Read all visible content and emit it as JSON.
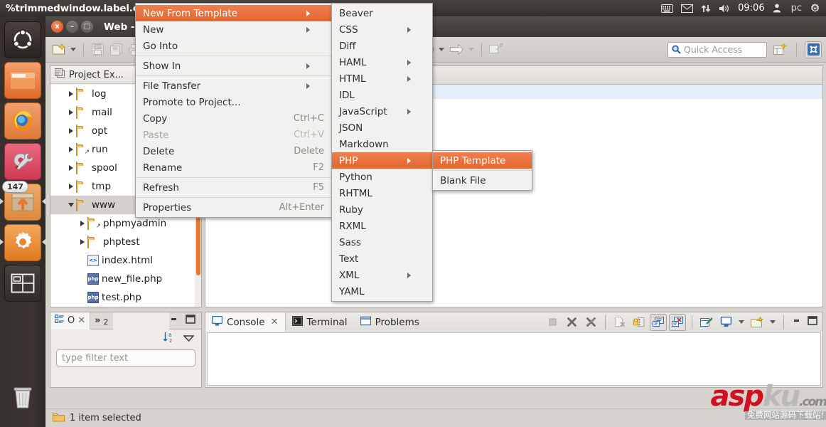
{
  "top_panel": {
    "app_menu_title": "%trimmedwindow.label.e",
    "indicators": [
      {
        "name": "keyboard-indicator-icon",
        "glyph": "⌨"
      },
      {
        "name": "messaging-indicator-icon",
        "glyph": "✉"
      },
      {
        "name": "network-indicator-icon",
        "glyph": "⇅"
      },
      {
        "name": "sound-indicator-icon",
        "glyph": "🔊"
      }
    ],
    "clock": "09:06",
    "user": "pc",
    "session_icon": "power-gear-icon"
  },
  "launcher": {
    "items": [
      {
        "name": "ubuntu-dash",
        "label": "Dash home"
      },
      {
        "name": "files",
        "label": "Files"
      },
      {
        "name": "firefox",
        "label": "Firefox Web Browser"
      },
      {
        "name": "system-tools",
        "label": "System Tools"
      },
      {
        "name": "software-updater",
        "label": "Software Updater",
        "badge": "147"
      },
      {
        "name": "settings",
        "label": "System Settings"
      },
      {
        "name": "workspace-switcher",
        "label": "Workspace Switcher"
      }
    ],
    "trash": "Trash"
  },
  "window": {
    "title": "Web - ",
    "close": "x",
    "minimize": "–",
    "maximize": "□"
  },
  "toolbar": {
    "new_label": "New",
    "save_label": "Save",
    "save_all_label": "Save All",
    "print_label": "Print",
    "back_label": "Back",
    "forward_label": "Forward",
    "quick_access": {
      "placeholder": "Quick Access",
      "icon": "search-icon"
    },
    "open_perspective_label": "Open Perspective",
    "web_perspective_label": "Web"
  },
  "project_explorer": {
    "tab_label": "Project Ex...",
    "tree": [
      {
        "label": "log",
        "type": "folder",
        "indent": 1,
        "twisty": "right",
        "link": false,
        "selected": false
      },
      {
        "label": "mail",
        "type": "folder",
        "indent": 1,
        "twisty": "right",
        "link": false,
        "selected": false
      },
      {
        "label": "opt",
        "type": "folder",
        "indent": 1,
        "twisty": "right",
        "link": false,
        "selected": false
      },
      {
        "label": "run",
        "type": "folder",
        "indent": 1,
        "twisty": "right",
        "link": true,
        "selected": false
      },
      {
        "label": "spool",
        "type": "folder",
        "indent": 1,
        "twisty": "right",
        "link": false,
        "selected": false
      },
      {
        "label": "tmp",
        "type": "folder",
        "indent": 1,
        "twisty": "right",
        "link": false,
        "selected": false
      },
      {
        "label": "www",
        "type": "folder",
        "indent": 1,
        "twisty": "down",
        "link": false,
        "selected": true
      },
      {
        "label": "phpmyadmin",
        "type": "folder",
        "indent": 2,
        "twisty": "right",
        "link": true,
        "selected": false
      },
      {
        "label": "phptest",
        "type": "folder",
        "indent": 2,
        "twisty": "right",
        "link": false,
        "selected": false
      },
      {
        "label": "index.html",
        "type": "html",
        "indent": 2,
        "twisty": "none",
        "link": false,
        "selected": false
      },
      {
        "label": "new_file.php",
        "type": "php",
        "indent": 2,
        "twisty": "none",
        "link": false,
        "selected": false
      },
      {
        "label": "test.php",
        "type": "php",
        "indent": 2,
        "twisty": "none",
        "link": false,
        "selected": false
      }
    ]
  },
  "outline_view": {
    "tab_label": "O",
    "overflow_tab_label": "»",
    "overflow_count": "2",
    "sort_icon": "sort-az-icon",
    "menu_icon": "view-menu-icon",
    "minimize_icon": "minimize-icon",
    "maximize_icon": "maximize-icon",
    "filter_placeholder": "type filter text"
  },
  "console_panel": {
    "tabs": [
      {
        "label": "Console",
        "icon": "console-icon",
        "active": true,
        "closable": true
      },
      {
        "label": "Terminal",
        "icon": "terminal-icon",
        "active": false,
        "closable": false
      },
      {
        "label": "Problems",
        "icon": "problems-icon",
        "active": false,
        "closable": false
      }
    ],
    "toolbar_icons": [
      "stop-icon",
      "clear-console-icon",
      "remove-all-terminated-icon",
      "clear-icon",
      "scroll-lock-icon",
      "pin-console-icon",
      "close-console-icon",
      "new-console-view-icon",
      "display-selected-console-icon",
      "display-selected-console-menu-icon",
      "open-console-icon",
      "open-console-menu-icon",
      "minimize-icon",
      "maximize-icon"
    ]
  },
  "status_bar": {
    "icon": "folder-icon",
    "text": "1 item selected"
  },
  "context_menu": {
    "items": [
      {
        "label": "New From Template",
        "accel": "",
        "submenu": true,
        "highlighted": true,
        "disabled": false,
        "separator_after": false
      },
      {
        "label": "New",
        "accel": "",
        "submenu": true,
        "highlighted": false,
        "disabled": false,
        "separator_after": false
      },
      {
        "label": "Go Into",
        "accel": "",
        "submenu": false,
        "highlighted": false,
        "disabled": false,
        "separator_after": true
      },
      {
        "label": "Show In",
        "accel": "",
        "submenu": true,
        "highlighted": false,
        "disabled": false,
        "separator_after": true
      },
      {
        "label": "File Transfer",
        "accel": "",
        "submenu": true,
        "highlighted": false,
        "disabled": false,
        "separator_after": false
      },
      {
        "label": "Promote to Project...",
        "accel": "",
        "submenu": false,
        "highlighted": false,
        "disabled": false,
        "separator_after": false
      },
      {
        "label": "Copy",
        "accel": "Ctrl+C",
        "submenu": false,
        "highlighted": false,
        "disabled": false,
        "separator_after": false
      },
      {
        "label": "Paste",
        "accel": "Ctrl+V",
        "submenu": false,
        "highlighted": false,
        "disabled": true,
        "separator_after": false
      },
      {
        "label": "Delete",
        "accel": "Delete",
        "submenu": false,
        "highlighted": false,
        "disabled": false,
        "separator_after": false
      },
      {
        "label": "Rename",
        "accel": "F2",
        "submenu": false,
        "highlighted": false,
        "disabled": false,
        "separator_after": true
      },
      {
        "label": "Refresh",
        "accel": "F5",
        "submenu": false,
        "highlighted": false,
        "disabled": false,
        "separator_after": true
      },
      {
        "label": "Properties",
        "accel": "Alt+Enter",
        "submenu": false,
        "highlighted": false,
        "disabled": false,
        "separator_after": false
      }
    ]
  },
  "template_menu": {
    "items": [
      {
        "label": "Beaver",
        "submenu": false,
        "highlighted": false
      },
      {
        "label": "CSS",
        "submenu": true,
        "highlighted": false
      },
      {
        "label": "Diff",
        "submenu": false,
        "highlighted": false
      },
      {
        "label": "HAML",
        "submenu": true,
        "highlighted": false
      },
      {
        "label": "HTML",
        "submenu": true,
        "highlighted": false
      },
      {
        "label": "IDL",
        "submenu": false,
        "highlighted": false
      },
      {
        "label": "JavaScript",
        "submenu": true,
        "highlighted": false
      },
      {
        "label": "JSON",
        "submenu": false,
        "highlighted": false
      },
      {
        "label": "Markdown",
        "submenu": false,
        "highlighted": false
      },
      {
        "label": "PHP",
        "submenu": true,
        "highlighted": true
      },
      {
        "label": "Python",
        "submenu": false,
        "highlighted": false
      },
      {
        "label": "RHTML",
        "submenu": false,
        "highlighted": false
      },
      {
        "label": "Ruby",
        "submenu": false,
        "highlighted": false
      },
      {
        "label": "RXML",
        "submenu": false,
        "highlighted": false
      },
      {
        "label": "Sass",
        "submenu": false,
        "highlighted": false
      },
      {
        "label": "Text",
        "submenu": false,
        "highlighted": false
      },
      {
        "label": "XML",
        "submenu": true,
        "highlighted": false
      },
      {
        "label": "YAML",
        "submenu": false,
        "highlighted": false
      }
    ]
  },
  "php_menu": {
    "items": [
      {
        "label": "PHP Template",
        "highlighted": true,
        "separator_after": true
      },
      {
        "label": "Blank File",
        "highlighted": false,
        "separator_after": false
      }
    ]
  },
  "watermark": {
    "part1": "asp",
    "part2": "ku",
    "part3": ".com",
    "subtitle": "免费网站源码下载站!"
  },
  "colors": {
    "menu_highlight": "#e3682f",
    "launcher_bg": "#36302e",
    "panel_bg": "#3c3835",
    "selection_grey": "#d4d0cb",
    "editor_highlight": "#e4eefb",
    "scrollbar_orange": "#e8772e"
  }
}
